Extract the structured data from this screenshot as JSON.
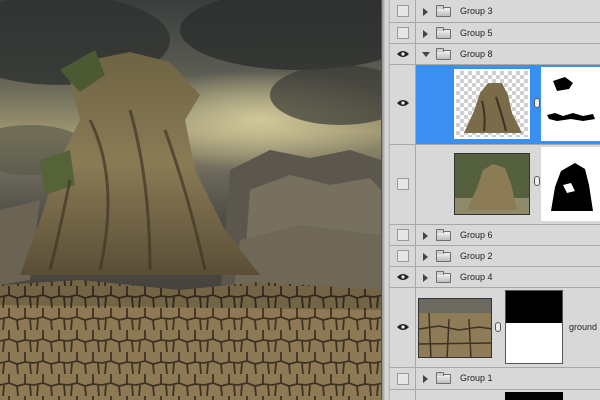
{
  "canvas": {
    "description_icon": "photo-canvas"
  },
  "layers": [
    {
      "name": "Group 3",
      "type": "group",
      "visible": false,
      "expanded": false
    },
    {
      "name": "Group 5",
      "type": "group",
      "visible": false,
      "expanded": false
    },
    {
      "name": "Group 8",
      "type": "group",
      "visible": true,
      "expanded": true
    },
    {
      "name": "",
      "type": "layer",
      "visible": true,
      "selected": true,
      "masked": true
    },
    {
      "name": "",
      "type": "layer",
      "visible": false,
      "selected": false,
      "masked": true
    },
    {
      "name": "Group 6",
      "type": "group",
      "visible": false,
      "expanded": false
    },
    {
      "name": "Group 2",
      "type": "group",
      "visible": false,
      "expanded": false
    },
    {
      "name": "Group 4",
      "type": "group",
      "visible": true,
      "expanded": true
    },
    {
      "name": "ground",
      "type": "layer",
      "visible": true,
      "selected": false,
      "masked": true
    },
    {
      "name": "Group 1",
      "type": "group",
      "visible": false,
      "expanded": false
    }
  ],
  "colors": {
    "selection": "#3b8ff0",
    "panel_bg": "#d8d8d8"
  }
}
